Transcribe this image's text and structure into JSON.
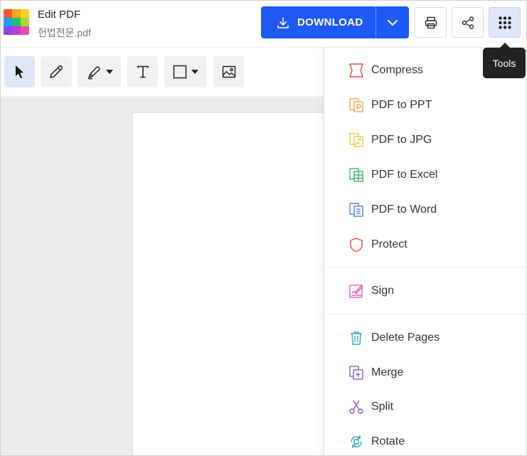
{
  "header": {
    "title": "Edit PDF",
    "filename": "헌법전문.pdf",
    "download_label": "DOWNLOAD",
    "logo_colors": [
      "#f25b2a",
      "#f5a623",
      "#f8d21c",
      "#1ea0f0",
      "#18c46b",
      "#a8d82c",
      "#8e44f0",
      "#c03ad8",
      "#e84bb4"
    ],
    "icons": {
      "download": "download-icon",
      "caret": "chevron-down-icon",
      "print": "print-icon",
      "share": "share-icon",
      "tools": "grid-dots-icon"
    }
  },
  "toolbar": {
    "tools": [
      {
        "name": "select",
        "icon": "cursor-arrow-icon"
      },
      {
        "name": "pencil",
        "icon": "pencil-icon"
      },
      {
        "name": "highlighter",
        "icon": "marker-icon"
      },
      {
        "name": "text",
        "icon": "text-T-icon"
      },
      {
        "name": "shape",
        "icon": "square-icon"
      },
      {
        "name": "image",
        "icon": "image-icon"
      }
    ]
  },
  "tooltip": {
    "text": "Tools"
  },
  "menu": {
    "items": [
      {
        "label": "Compress",
        "color": "#e5484d"
      },
      {
        "label": "PDF to PPT",
        "color": "#f0a040"
      },
      {
        "label": "PDF to JPG",
        "color": "#e8cc2a"
      },
      {
        "label": "PDF to Excel",
        "color": "#2fb35a"
      },
      {
        "label": "PDF to Word",
        "color": "#3b7bd8"
      },
      {
        "label": "Protect",
        "color": "#e5484d"
      },
      {
        "label": "Sign",
        "color": "#d94fb0"
      },
      {
        "label": "Delete Pages",
        "color": "#28b0b8"
      },
      {
        "label": "Merge",
        "color": "#7b55c8"
      },
      {
        "label": "Split",
        "color": "#9b50c8"
      },
      {
        "label": "Rotate",
        "color": "#28a8b0"
      }
    ]
  }
}
